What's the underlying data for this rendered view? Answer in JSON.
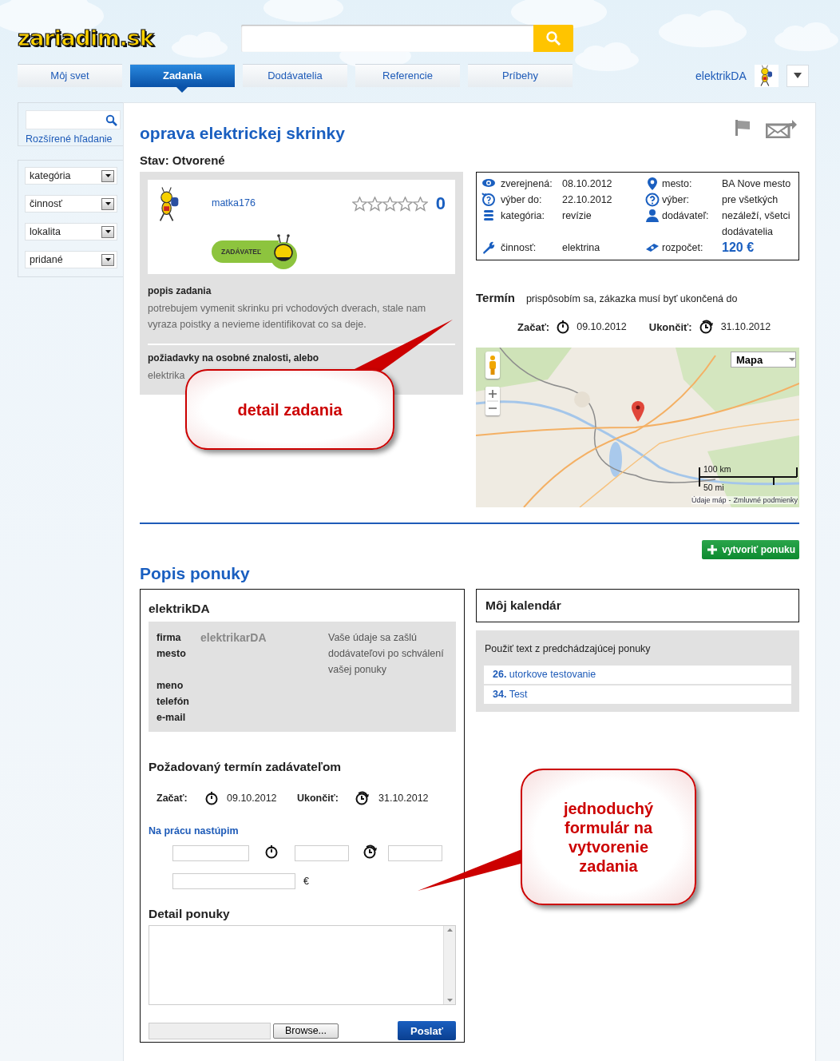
{
  "logo": "zariadim.sk",
  "tabs": [
    {
      "label": "Môj svet",
      "selected": false
    },
    {
      "label": "Zadania",
      "selected": true
    },
    {
      "label": "Dodávatelia",
      "selected": false
    },
    {
      "label": "Referencie",
      "selected": false
    },
    {
      "label": "Príbehy",
      "selected": false
    }
  ],
  "user": {
    "name": "elektrikDA"
  },
  "sidebar": {
    "advanced_search": "Rozšírené hľadanie",
    "filters": [
      "kategória",
      "činnosť",
      "lokalita",
      "pridané"
    ]
  },
  "task": {
    "title": "oprava elektrickej skrinky",
    "status": "Stav: Otvorené",
    "author": "matka176",
    "stars": 0,
    "rating_count": "0",
    "role_badge": "ZADÁVATEĽ",
    "description_heading": "popis zadania",
    "description": "potrebujem vymenit skrinku pri vchodových dverach, stale nam vyraza poistky a nevieme identifikovat co sa deje.",
    "requirements_heading": "požiadavky na osobné znalosti, alebo",
    "requirements": "elektrika"
  },
  "details": [
    {
      "label": "zverejnená:",
      "value": "08.10.2012",
      "kind": "text"
    },
    {
      "label": "mesto:",
      "value": "BA Nove mesto",
      "kind": "text"
    },
    {
      "label": "výber do:",
      "value": "22.10.2012",
      "kind": "text"
    },
    {
      "label": "výber:",
      "value": "pre všetkých",
      "kind": "text"
    },
    {
      "label": "kategória:",
      "value": "revízie",
      "kind": "text"
    },
    {
      "label": "dodávateľ:",
      "value": "nezáleží, všetci dodávatelia",
      "kind": "text"
    },
    {
      "label": "činnosť:",
      "value": "elektrina",
      "kind": "text"
    },
    {
      "label": "rozpočet:",
      "value": "120 €",
      "kind": "price"
    }
  ],
  "schedule": {
    "heading": "Termín",
    "note": "prispôsobím sa, zákazka musí byť ukončená do",
    "start_label": "Začať:",
    "start": "09.10.2012",
    "end_label": "Ukončiť:",
    "end": "31.10.2012"
  },
  "map": {
    "map_type": "Mapa",
    "scale_km": "100 km",
    "scale_mi": "50 mi",
    "links": [
      "Údaje máp",
      "Zmluvné podmienky"
    ],
    "link_separator": "-"
  },
  "create_offer_button": "vytvoriť ponuku",
  "offer": {
    "heading": "Popis ponuky",
    "supplier": "elektrikDA",
    "company_fields": [
      {
        "label": "firma",
        "value": "elektrikarDA"
      },
      {
        "label": "mesto"
      }
    ],
    "contact_fields": [
      {
        "label": "meno"
      },
      {
        "label": "telefón"
      },
      {
        "label": "e-mail"
      }
    ],
    "note": "Vaše údaje sa zašlú dodávateľovi po schválení vašej ponuky"
  },
  "deadline": {
    "heading": "Požadovaný termín zadávateľom",
    "start_label": "Začať:",
    "start": "09.10.2012",
    "end_label": "Ukončiť:",
    "end": "31.10.2012"
  },
  "start_work": {
    "heading": "Na prácu nastúpim",
    "currency": "€"
  },
  "detail": {
    "heading": "Detail ponuky"
  },
  "browse_button": "Browse...",
  "submit_button": "Poslať",
  "calendar": {
    "title": "Môj kalendár",
    "hint": "Použiť text z predchádzajúcej ponuky",
    "offers": [
      "**26.** utorkove testovanie",
      "**34.** Test"
    ]
  },
  "callouts": [
    "detail zadania",
    "jednoduchý formulár na vytvorenie zadania"
  ]
}
